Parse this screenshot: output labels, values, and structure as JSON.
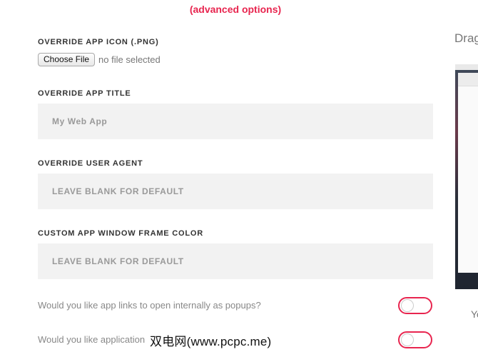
{
  "advanced_link": "(advanced options)",
  "fields": {
    "app_icon": {
      "label": "OVERRIDE APP ICON (.PNG)",
      "button": "Choose File",
      "status": "no file selected"
    },
    "app_title": {
      "label": "OVERRIDE APP TITLE",
      "placeholder": "My Web App"
    },
    "user_agent": {
      "label": "OVERRIDE USER AGENT",
      "placeholder": "LEAVE BLANK FOR DEFAULT"
    },
    "frame_color": {
      "label": "CUSTOM APP WINDOW FRAME COLOR",
      "placeholder": "LEAVE BLANK FOR DEFAULT"
    }
  },
  "questions": [
    {
      "text": "Would you like app links to open internally as popups?",
      "enabled": false
    },
    {
      "text": "Would you like application",
      "enabled": false
    }
  ],
  "side": {
    "heading": "Drag",
    "snippet": "Yo"
  },
  "watermark": "双电网(www.pcpc.me)",
  "colors": {
    "accent": "#e8254f",
    "input_bg": "#f2f2f2"
  }
}
